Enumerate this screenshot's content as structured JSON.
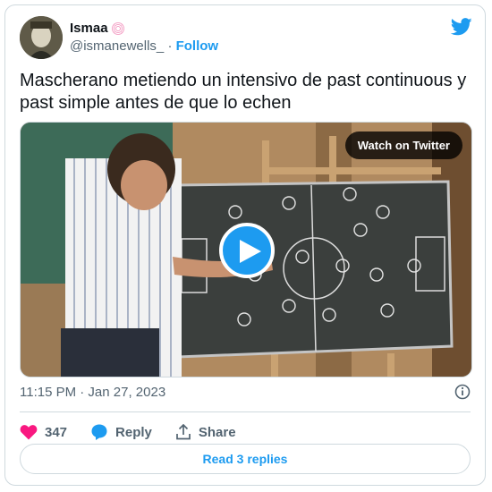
{
  "tweet": {
    "author_name": "Ismaa",
    "handle": "@ismanewells_",
    "separator": "·",
    "follow_label": "Follow",
    "text": "Mascherano metiendo un intensivo de past continuous y past simple antes de que lo echen",
    "timestamp": "11:15 PM · Jan 27, 2023"
  },
  "media": {
    "watch_label": "Watch on Twitter"
  },
  "actions": {
    "like_count": "347",
    "reply_label": "Reply",
    "share_label": "Share"
  },
  "footer": {
    "read_replies_label": "Read 3 replies"
  },
  "colors": {
    "accent": "#1d9bf0",
    "like": "#f91880",
    "muted": "#536471",
    "border": "#cfd9de"
  },
  "icons": [
    "twitter-bird-icon",
    "verified-style-badge-icon",
    "play-icon",
    "info-icon",
    "heart-icon",
    "reply-bubble-icon",
    "share-icon"
  ]
}
